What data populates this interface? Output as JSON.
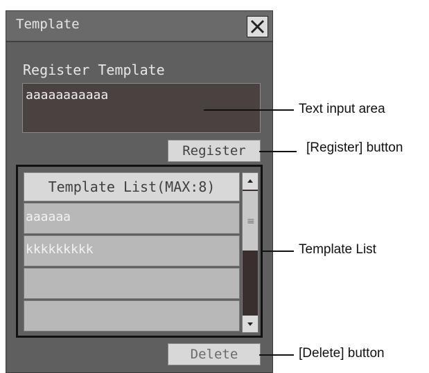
{
  "window": {
    "title": "Template",
    "close_icon": "close-icon"
  },
  "register": {
    "label": "Register Template",
    "input_value": "aaaaaaaaaaa",
    "button_label": "Register"
  },
  "template_list": {
    "header": "Template List(MAX:8)",
    "rows": [
      "aaaaaa",
      "kkkkkkkkk",
      "",
      ""
    ]
  },
  "delete": {
    "button_label": "Delete"
  },
  "callouts": {
    "text_input": "Text input area",
    "register_button": "[Register] button",
    "template_list": "Template List",
    "delete_button": "[Delete] button"
  },
  "colors": {
    "panel": "#5f5f5f",
    "input_bg": "#4a4141",
    "button": "#d8d8d8",
    "row": "#b8b8b8"
  }
}
